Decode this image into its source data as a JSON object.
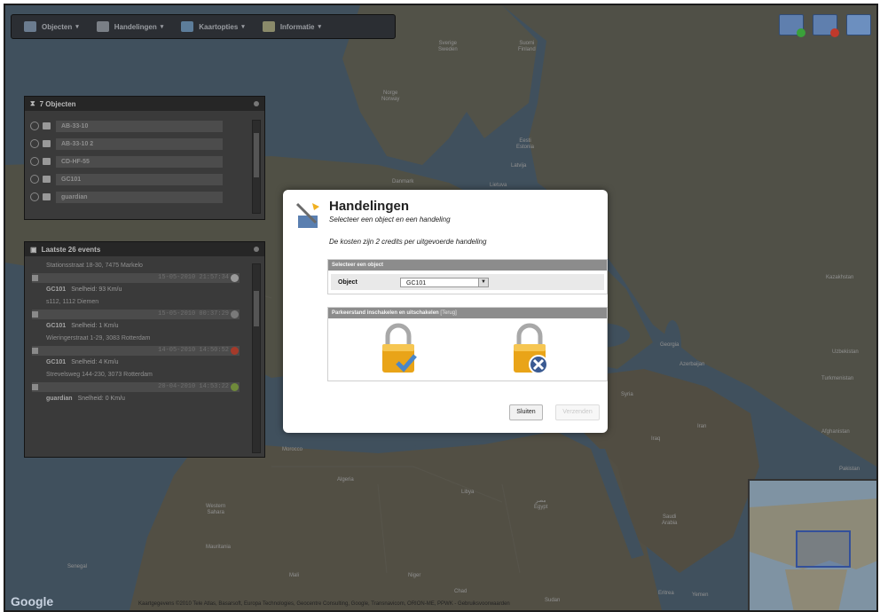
{
  "toolbar": {
    "menus": [
      {
        "label": "Objecten",
        "icon": "home-icon"
      },
      {
        "label": "Handelingen",
        "icon": "satellite-icon"
      },
      {
        "label": "Kaartopties",
        "icon": "map-icon"
      },
      {
        "label": "Informatie",
        "icon": "info-icon"
      }
    ]
  },
  "objects_panel": {
    "title": "7 Objecten",
    "items": [
      {
        "label": "AB-33-10",
        "icon": "car-icon"
      },
      {
        "label": "AB-33-10 2",
        "icon": "people-icon"
      },
      {
        "label": "CD-HF-55",
        "icon": "truck-icon"
      },
      {
        "label": "GC101",
        "icon": "car-icon"
      },
      {
        "label": "guardian",
        "icon": "person-icon"
      }
    ]
  },
  "events_panel": {
    "title": "Laatste 26 events",
    "events": [
      {
        "address": "Stationsstraat 18-30, 7475 Markelo",
        "date": "15-05-2010 21:57:34",
        "object": "GC101",
        "speed": "Snelheid: 93 Km/u",
        "status_color": "#9a9a9a"
      },
      {
        "address": "s112, 1112 Diemen",
        "date": "15-05-2010 00:37:29",
        "object": "GC101",
        "speed": "Snelheid: 1 Km/u",
        "status_color": "#7a7a7a"
      },
      {
        "address": "Wieringerstraat 1-29, 3083 Rotterdam",
        "date": "14-05-2010 14:50:52",
        "object": "GC101",
        "speed": "Snelheid: 4 Km/u",
        "status_color": "#a53a2a"
      },
      {
        "address": "Strevelsweg 144-230, 3073 Rotterdam",
        "date": "20-04-2010 14:53:22",
        "object": "guardian",
        "speed": "Snelheid: 0 Km/u",
        "status_color": "#6f8a3a"
      }
    ]
  },
  "dialog": {
    "title": "Handelingen",
    "subtitle": "Selecteer een object en een handeling",
    "cost_text": "De kosten zijn 2 credits per uitgevoerde handeling",
    "select_section": {
      "header": "Selecteer een object",
      "field_label": "Object",
      "field_value": "GC101"
    },
    "action_section": {
      "header": "Parkeerstand inschakelen en uitschakelen",
      "back_link": "[Terug]",
      "actions": [
        {
          "name": "lock-enable-icon"
        },
        {
          "name": "lock-disable-icon"
        }
      ]
    },
    "close_button": "Sluiten",
    "send_button": "Verzenden"
  },
  "map_labels": [
    {
      "text": "Sverige",
      "sub": "Sweden"
    },
    {
      "text": "Suomi",
      "sub": "Finland"
    },
    {
      "text": "Norge",
      "sub": "Norway"
    },
    {
      "text": "Eesti",
      "sub": "Estonia"
    },
    {
      "text": "Latvija",
      "sub": ""
    },
    {
      "text": "Lietuva",
      "sub": ""
    },
    {
      "text": "Danmark",
      "sub": ""
    },
    {
      "text": "Kazakhstan",
      "sub": ""
    },
    {
      "text": "Uzbekistan",
      "sub": ""
    },
    {
      "text": "Turkmenistan",
      "sub": ""
    },
    {
      "text": "Afghanistan",
      "sub": ""
    },
    {
      "text": "Pakistan",
      "sub": ""
    },
    {
      "text": "Syria",
      "sub": ""
    },
    {
      "text": "Iraq",
      "sub": ""
    },
    {
      "text": "Iran",
      "sub": ""
    },
    {
      "text": "Georgia",
      "sub": ""
    },
    {
      "text": "Azerbaijan",
      "sub": ""
    },
    {
      "text": "Morocco",
      "sub": ""
    },
    {
      "text": "Algeria",
      "sub": ""
    },
    {
      "text": "Libya",
      "sub": ""
    },
    {
      "text": "مصر",
      "sub": "Egypt"
    },
    {
      "text": "Western",
      "sub": "Sahara"
    },
    {
      "text": "Mauritania",
      "sub": ""
    },
    {
      "text": "Mali",
      "sub": ""
    },
    {
      "text": "Niger",
      "sub": ""
    },
    {
      "text": "Chad",
      "sub": ""
    },
    {
      "text": "Sudan",
      "sub": ""
    },
    {
      "text": "Saudi",
      "sub": "Arabia"
    },
    {
      "text": "Yemen",
      "sub": ""
    },
    {
      "text": "Eritrea",
      "sub": ""
    },
    {
      "text": "Senegal",
      "sub": ""
    }
  ],
  "footer": {
    "logo": "Google",
    "attribution": "Kaartgegevens ©2010 Tele Atlas, Basarsoft, Europa Technologies, Geocentre Consulting, Google, Transnavicom, ORION-ME, PPWK - Gebruiksvoorwaarden"
  },
  "colors": {
    "dialog_bg": "#ffffff",
    "section_header": "#8c8c8c",
    "lock_gold": "#e9a418",
    "lock_enable_check": "#4a86c8",
    "lock_disable_x": "#3a5a92"
  }
}
